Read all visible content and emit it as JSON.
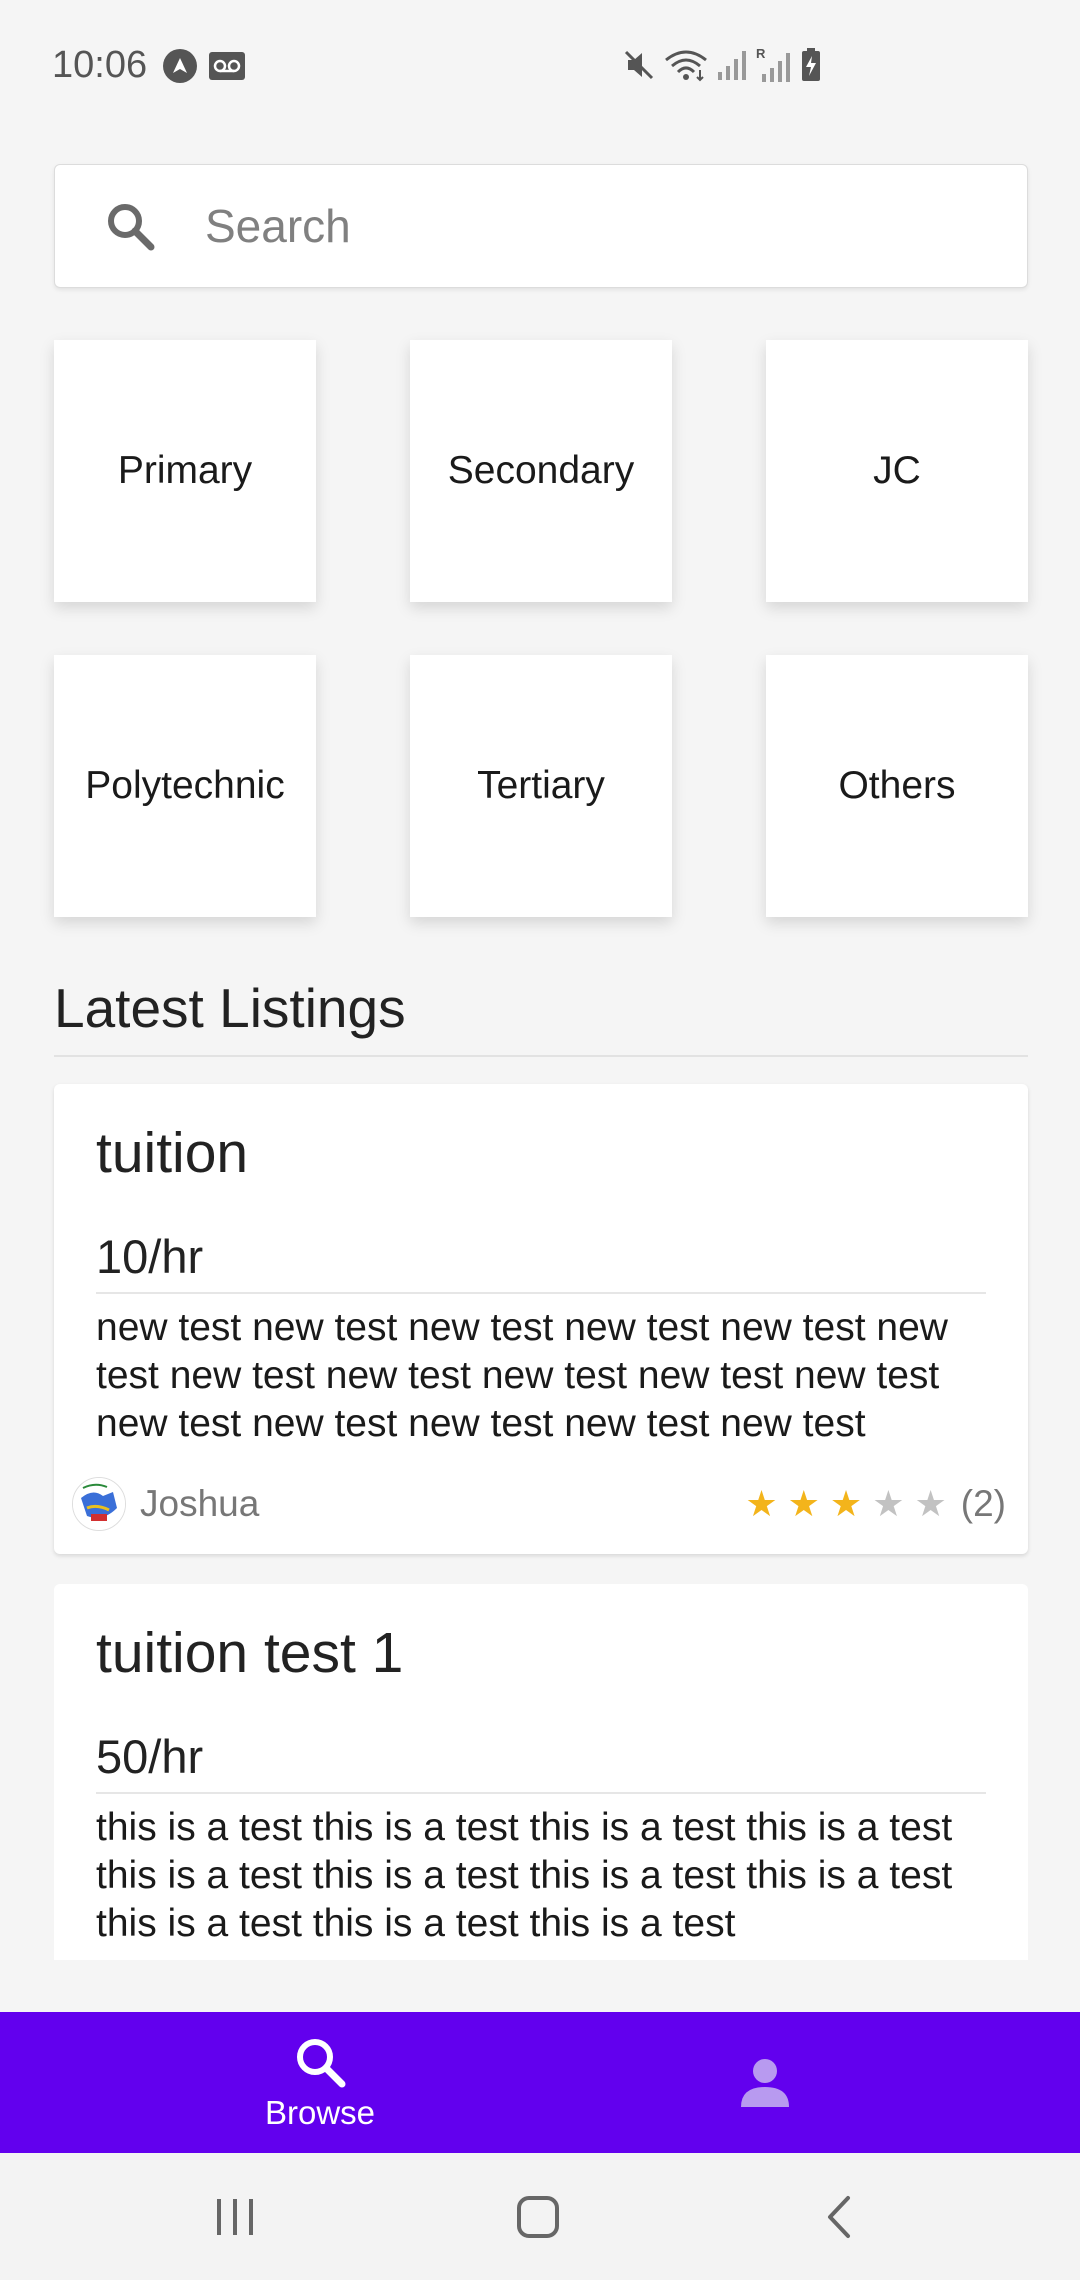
{
  "status_bar": {
    "time": "10:06",
    "left_icons": [
      "navigation-app-icon",
      "voicemail-icon"
    ],
    "right_icons": [
      "mute-icon",
      "wifi-icon",
      "signal-icon",
      "roaming-signal-icon",
      "battery-charging-icon"
    ],
    "roaming_label": "R"
  },
  "search": {
    "placeholder": "Search",
    "value": ""
  },
  "categories": [
    {
      "label": "Primary"
    },
    {
      "label": "Secondary"
    },
    {
      "label": "JC"
    },
    {
      "label": "Polytechnic"
    },
    {
      "label": "Tertiary"
    },
    {
      "label": "Others"
    }
  ],
  "latest": {
    "title": "Latest Listings",
    "listings": [
      {
        "title": "tuition",
        "price": "10/hr",
        "description": "new test new test new test new test new test new test new test new test new test new test new test new test new test new test new test new test",
        "author": "Joshua",
        "rating": 3,
        "max_rating": 5,
        "review_count": "(2)"
      },
      {
        "title": "tuition test 1",
        "price": "50/hr",
        "description": "this is a test this is a test this is a test this is a test this is a test this is a test this is a test this is a test this is a test this is a test this is a test"
      }
    ]
  },
  "bottom_nav": {
    "items": [
      {
        "label": "Browse",
        "icon": "search-icon",
        "active": true
      },
      {
        "label": "",
        "icon": "person-icon",
        "active": false
      }
    ]
  },
  "colors": {
    "accent": "#6200ee",
    "star_on": "#f3b41b",
    "star_off": "#c2c2c2",
    "background": "#f5f5f5"
  }
}
